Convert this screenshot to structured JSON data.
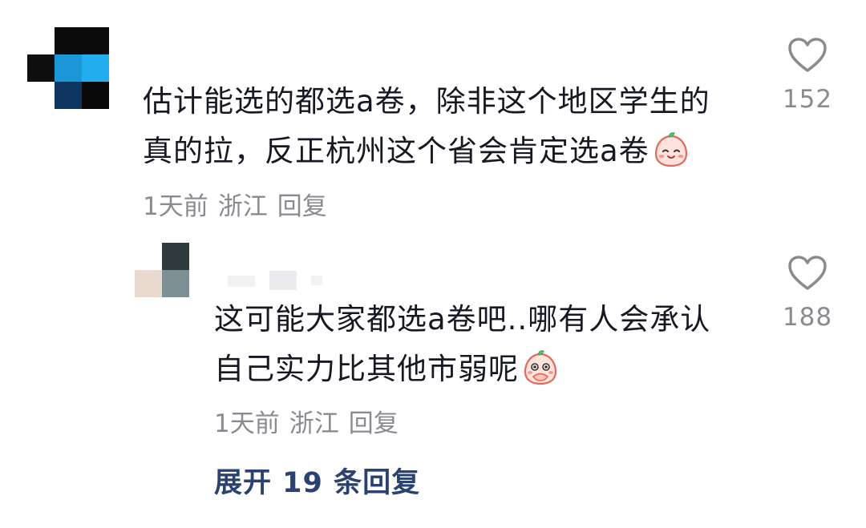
{
  "comments": [
    {
      "lines": [
        "估计能选的都选a卷，除非这个地区学生的",
        "真的拉，反正杭州这个省会肯定选a卷"
      ],
      "emoji": "smiling-peach-emoji",
      "time": "1天前",
      "location": "浙江",
      "reply_label": "回复",
      "like_count": "152"
    },
    {
      "lines": [
        "这可能大家都选a卷吧..哪有人会承认",
        "自己实力比其他市弱呢"
      ],
      "emoji": "giggling-peach-emoji",
      "time": "1天前",
      "location": "浙江",
      "reply_label": "回复",
      "like_count": "188"
    }
  ],
  "expand": {
    "label": "展开 19 条回复"
  },
  "colors": {
    "text": "#161823",
    "meta": "#8a8b91",
    "link": "#2b4170",
    "avatar1": [
      "#0a0a0a",
      "#1a9fe6",
      "#0d3b66"
    ],
    "avatar2": [
      "#2f3b3d",
      "#e8d8ce",
      "#7d8f92"
    ]
  }
}
